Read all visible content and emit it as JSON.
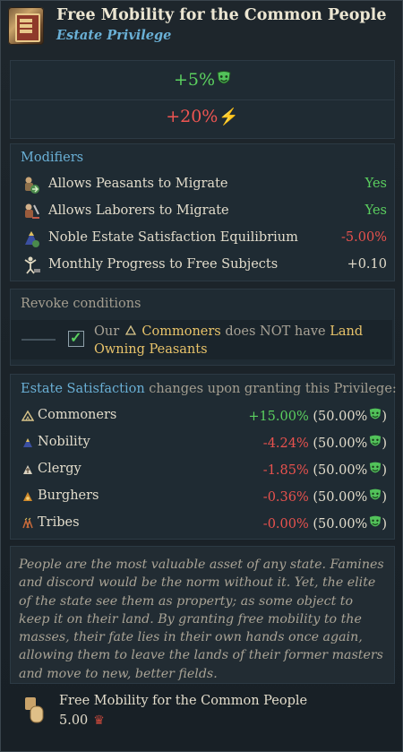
{
  "header": {
    "title": "Free Mobility for the Common People",
    "subtitle": "Estate Privilege",
    "icon": "privilege-scroll-icon"
  },
  "effects": {
    "satisfaction": "+5%",
    "power": "+20%",
    "satisfaction_icon": "green-mask-icon",
    "power_icon": "lightning-bolt-icon"
  },
  "modifiers": {
    "title": "Modifiers",
    "rows": [
      {
        "label": "Allows Peasants to Migrate",
        "value": "Yes",
        "icon": "peasants-migrate-icon"
      },
      {
        "label": "Allows Laborers to Migrate",
        "value": "Yes",
        "icon": "laborers-migrate-icon"
      },
      {
        "label": "Noble Estate Satisfaction Equilibrium",
        "value": "-5.00%",
        "icon": "nobility-estate-icon"
      },
      {
        "label": "Monthly Progress to Free Subjects",
        "value": "+0.10",
        "icon": "free-subjects-icon"
      }
    ]
  },
  "revoke": {
    "title": "Revoke conditions",
    "text_our": "Our",
    "estate_name": "Commoners",
    "text_mid": "does NOT have",
    "condition": "Land Owning Peasants"
  },
  "estate_satisfaction": {
    "title_highlight": "Estate Satisfaction",
    "title_rest": "changes upon granting this Privilege:",
    "rows": [
      {
        "name": "Commoners",
        "change": "+15.00%",
        "base": "(50.00%",
        "icon": "commoners-icon"
      },
      {
        "name": "Nobility",
        "change": "-4.24%",
        "base": "(50.00%",
        "icon": "nobility-icon"
      },
      {
        "name": "Clergy",
        "change": "-1.85%",
        "base": "(50.00%",
        "icon": "clergy-icon"
      },
      {
        "name": "Burghers",
        "change": "-0.36%",
        "base": "(50.00%",
        "icon": "burghers-icon"
      },
      {
        "name": "Tribes",
        "change": "-0.00%",
        "base": "(50.00%",
        "icon": "tribes-icon"
      }
    ],
    "close_paren": ")"
  },
  "flavor_text": "People are the most valuable asset of any state. Famines and discord would be the norm without it. Yet, the elite of the state see them as property; as some object to keep it on their land. By granting free mobility to the masses, their fate lies in their own hands once again, allowing them to leave the lands of their former masters and move to new, better fields.",
  "footer": {
    "title": "Free Mobility for the Common People",
    "cost": "5.00",
    "cost_icon": "crown-icon"
  },
  "colors": {
    "accent_blue": "#6ab0d6",
    "positive": "#5bd05f",
    "negative": "#e9524e",
    "gold": "#e8c36a"
  }
}
